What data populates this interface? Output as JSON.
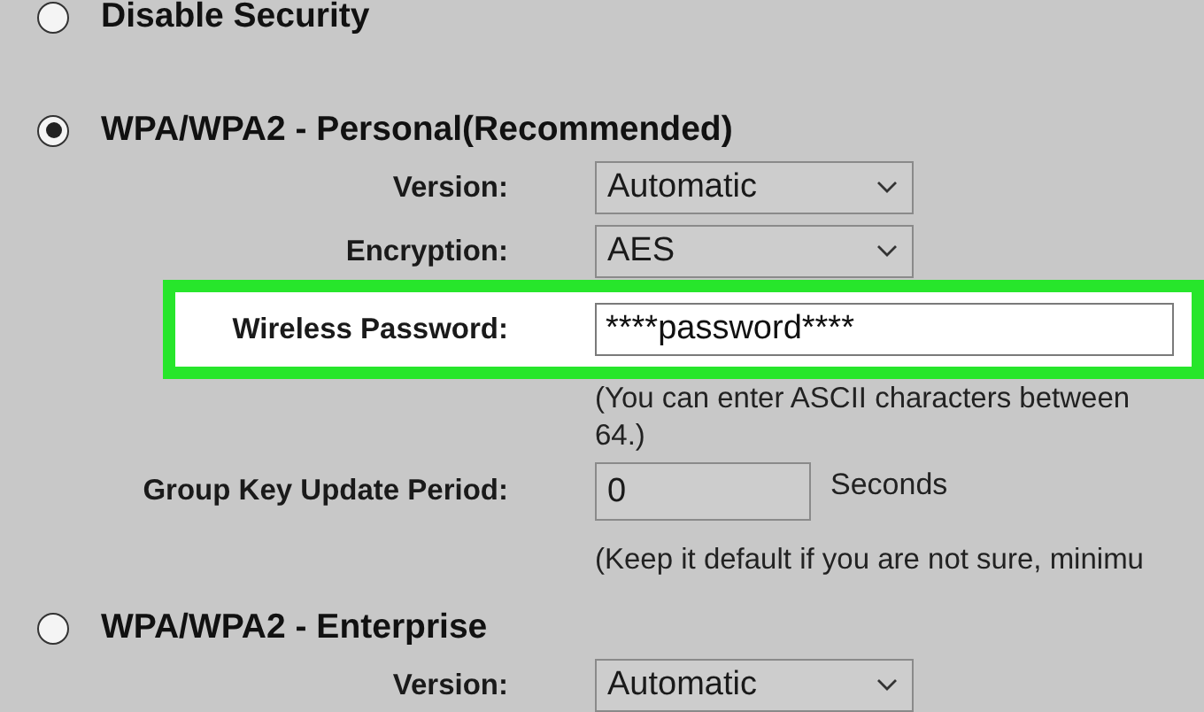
{
  "security_options": [
    {
      "label": "Disable Security",
      "selected": false
    },
    {
      "label": "WPA/WPA2 - Personal(Recommended)",
      "selected": true,
      "fields": [
        {
          "kind": "select",
          "label": "Version:",
          "value": "Automatic"
        },
        {
          "kind": "select",
          "label": "Encryption:",
          "value": "AES"
        },
        {
          "kind": "password",
          "label": "Wireless Password:",
          "value": "****password****",
          "highlighted": true
        },
        {
          "kind": "note",
          "lines": [
            "(You can enter ASCII characters between",
            "64.)"
          ]
        },
        {
          "kind": "number",
          "label": "Group Key Update Period:",
          "value": "0",
          "unit": "Seconds"
        },
        {
          "kind": "note",
          "lines": [
            "(Keep it default if you are not sure, minimu"
          ]
        }
      ]
    },
    {
      "label": "WPA/WPA2 - Enterprise",
      "selected": false,
      "fields": [
        {
          "kind": "select",
          "label": "Version:",
          "value": "Automatic"
        }
      ]
    }
  ]
}
